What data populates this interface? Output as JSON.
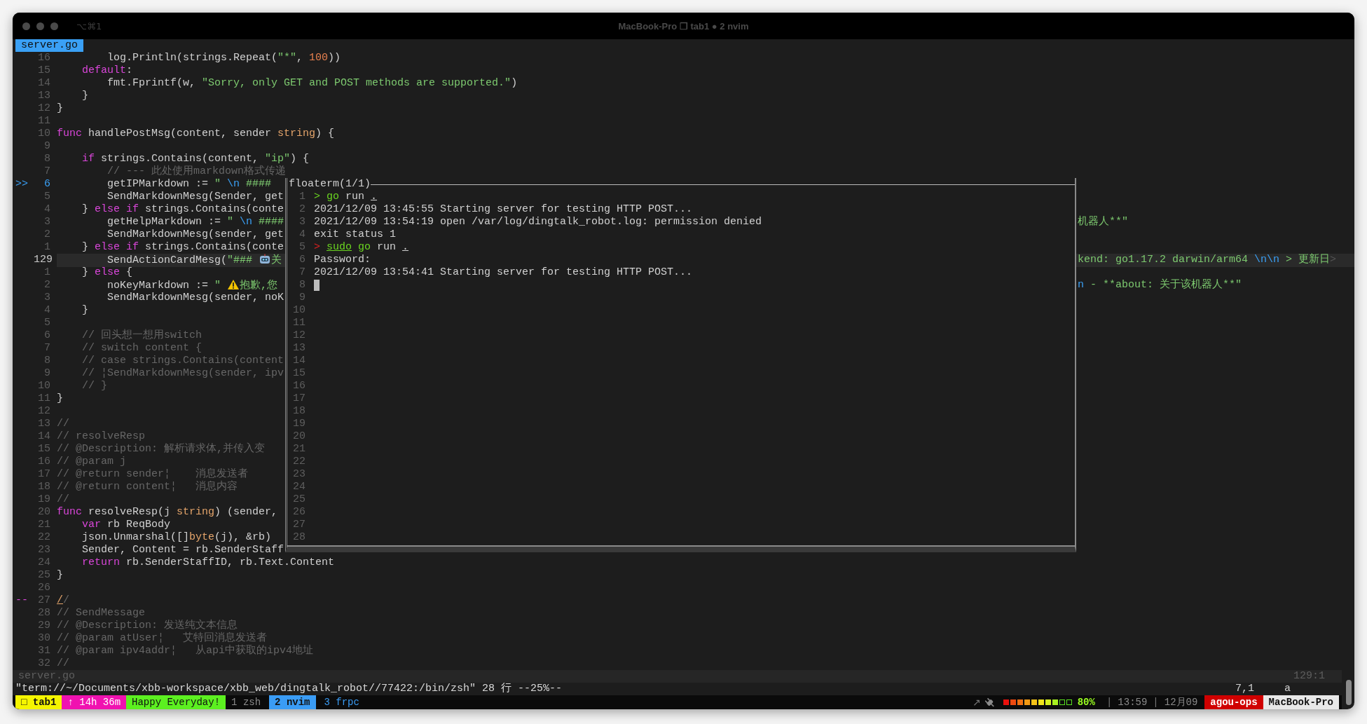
{
  "window": {
    "shortcut": "⌥⌘1",
    "title": "MacBook-Pro ❐ tab1 ● 2 nvim"
  },
  "winbar": {
    "file": "server.go"
  },
  "editor": {
    "lines": [
      {
        "num": "16",
        "current": false,
        "code": [
          "        log.Println(strings.Repeat(",
          {
            "kind": "string",
            "text": "\"*\""
          },
          ", ",
          {
            "kind": "number",
            "text": "100"
          },
          "))"
        ]
      },
      {
        "num": "15",
        "current": false,
        "code": [
          {
            "kind": "keyword",
            "text": "    default"
          },
          ":"
        ]
      },
      {
        "num": "14",
        "current": false,
        "code": [
          "        fmt.Fprintf(w, ",
          {
            "kind": "string",
            "text": "\"Sorry, only GET and POST methods are supported.\""
          },
          ")"
        ]
      },
      {
        "num": "13",
        "current": false,
        "code": [
          "    }"
        ]
      },
      {
        "num": "12",
        "current": false,
        "code": [
          "}"
        ]
      },
      {
        "num": "11",
        "current": false
      },
      {
        "num": "10",
        "current": false,
        "code": [
          {
            "kind": "keyword",
            "text": "func"
          },
          " handlePostMsg(content, sender ",
          {
            "kind": "type",
            "text": "string"
          },
          ") {"
        ]
      },
      {
        "num": "9",
        "current": false
      },
      {
        "num": "8",
        "current": false,
        "code": [
          {
            "kind": "keyword",
            "text": "    if"
          },
          " strings.Contains(content, ",
          {
            "kind": "string",
            "text": "\"ip\""
          },
          ") {"
        ]
      },
      {
        "num": "7",
        "current": false,
        "code": [
          {
            "kind": "comment",
            "text": "        // --- 此处使用markdown格式传递"
          }
        ]
      },
      {
        "num": "6",
        "current": false,
        "sign": {
          "text": ">>",
          "kind": "jump"
        },
        "code": [
          "        getIPMarkdown := ",
          {
            "kind": "string",
            "text": "\" "
          },
          {
            "kind": "escape",
            "text": "\\n"
          },
          {
            "kind": "string",
            "text": " ####"
          }
        ]
      },
      {
        "num": "5",
        "current": false,
        "code": [
          "        SendMarkdownMesg(Sender, get"
        ]
      },
      {
        "num": "4",
        "current": false,
        "code": [
          "    } ",
          {
            "kind": "keyword",
            "text": "else if"
          },
          " strings.Contains(conte"
        ]
      },
      {
        "num": "3",
        "current": false,
        "code": [
          "        getHelpMarkdown := ",
          {
            "kind": "string",
            "text": "\" "
          },
          {
            "kind": "escape",
            "text": "\\n"
          },
          {
            "kind": "string",
            "text": " ####"
          }
        ],
        "right": [
          {
            "kind": "string",
            "text": "机器人**\""
          }
        ]
      },
      {
        "num": "2",
        "current": false,
        "code": [
          "        SendMarkdownMesg(sender, get"
        ]
      },
      {
        "num": "1",
        "current": false,
        "code": [
          "    } ",
          {
            "kind": "keyword",
            "text": "else if"
          },
          " strings.Contains(conte"
        ]
      },
      {
        "num": "129",
        "current": true,
        "code": [
          "        SendActionCardMesg(",
          {
            "kind": "string",
            "text": "\"### "
          },
          {
            "kind": "robot"
          },
          {
            "kind": "string",
            "text": "关"
          }
        ],
        "right": [
          {
            "kind": "string",
            "text": "kend: go1.17.2 darwin/arm64 "
          },
          {
            "kind": "escape",
            "text": "\\n\\n"
          },
          {
            "kind": "string",
            "text": " > 更新日"
          },
          {
            "kind": "more",
            "text": ">"
          }
        ]
      },
      {
        "num": "1",
        "current": false,
        "code": [
          "    } ",
          {
            "kind": "keyword",
            "text": "else"
          },
          " {"
        ]
      },
      {
        "num": "2",
        "current": false,
        "code": [
          "        noKeyMarkdown := ",
          {
            "kind": "string",
            "text": "\" "
          },
          {
            "kind": "warning"
          },
          {
            "kind": "string",
            "text": "抱歉,您"
          }
        ],
        "right": [
          {
            "kind": "escape",
            "text": "n"
          },
          {
            "kind": "string",
            "text": " - **about: 关于该机器人**\""
          }
        ]
      },
      {
        "num": "3",
        "current": false,
        "code": [
          "        SendMarkdownMesg(sender, noK"
        ]
      },
      {
        "num": "4",
        "current": false,
        "code": [
          "    }"
        ]
      },
      {
        "num": "5",
        "current": false
      },
      {
        "num": "6",
        "current": false,
        "code": [
          {
            "kind": "comment",
            "text": "    // 回头想一想用switch"
          }
        ]
      },
      {
        "num": "7",
        "current": false,
        "code": [
          {
            "kind": "comment",
            "text": "    // switch content {"
          }
        ]
      },
      {
        "num": "8",
        "current": false,
        "code": [
          {
            "kind": "comment",
            "text": "    // case strings.Contains(content"
          }
        ]
      },
      {
        "num": "9",
        "current": false,
        "code": [
          {
            "kind": "comment",
            "text": "    // ¦SendMarkdownMesg(sender, ipv"
          }
        ]
      },
      {
        "num": "10",
        "current": false,
        "code": [
          {
            "kind": "comment",
            "text": "    // }"
          }
        ]
      },
      {
        "num": "11",
        "current": false,
        "code": [
          "}"
        ]
      },
      {
        "num": "12",
        "current": false
      },
      {
        "num": "13",
        "current": false,
        "code": [
          {
            "kind": "comment",
            "text": "//"
          }
        ]
      },
      {
        "num": "14",
        "current": false,
        "code": [
          {
            "kind": "comment",
            "text": "// resolveResp"
          }
        ]
      },
      {
        "num": "15",
        "current": false,
        "code": [
          {
            "kind": "comment",
            "text": "// @Description: 解析请求体,并传入变"
          }
        ]
      },
      {
        "num": "16",
        "current": false,
        "code": [
          {
            "kind": "comment",
            "text": "// @param j"
          }
        ]
      },
      {
        "num": "17",
        "current": false,
        "code": [
          {
            "kind": "comment",
            "text": "// @return sender¦    消息发送者"
          }
        ]
      },
      {
        "num": "18",
        "current": false,
        "code": [
          {
            "kind": "comment",
            "text": "// @return content¦   消息内容"
          }
        ]
      },
      {
        "num": "19",
        "current": false,
        "code": [
          {
            "kind": "comment",
            "text": "//"
          }
        ]
      },
      {
        "num": "20",
        "current": false,
        "code": [
          {
            "kind": "keyword",
            "text": "func"
          },
          " resolveResp(j ",
          {
            "kind": "type",
            "text": "string"
          },
          ") (sender,"
        ]
      },
      {
        "num": "21",
        "current": false,
        "code": [
          {
            "kind": "keyword",
            "text": "    var"
          },
          " rb ReqBody"
        ]
      },
      {
        "num": "22",
        "current": false,
        "code": [
          "    json.Unmarshal([]",
          {
            "kind": "type",
            "text": "byte"
          },
          "(j), &rb)"
        ]
      },
      {
        "num": "23",
        "current": false,
        "code": [
          "    Sender, Content = rb.SenderStaff"
        ]
      },
      {
        "num": "24",
        "current": false,
        "code": [
          {
            "kind": "keyword",
            "text": "    return"
          },
          " rb.SenderStaffID, rb.Text.Content"
        ]
      },
      {
        "num": "25",
        "current": false,
        "code": [
          "}"
        ]
      },
      {
        "num": "26",
        "current": false
      },
      {
        "num": "27",
        "current": false,
        "sign": {
          "text": "--",
          "kind": "change"
        },
        "code": [
          {
            "kind": "match",
            "text": "/"
          },
          {
            "kind": "comment",
            "text": "/"
          }
        ]
      },
      {
        "num": "28",
        "current": false,
        "code": [
          {
            "kind": "comment",
            "text": "// SendMessage"
          }
        ]
      },
      {
        "num": "29",
        "current": false,
        "code": [
          {
            "kind": "comment",
            "text": "// @Description: 发送纯文本信息"
          }
        ]
      },
      {
        "num": "30",
        "current": false,
        "code": [
          {
            "kind": "comment",
            "text": "// @param atUser¦   艾特回消息发送者"
          }
        ]
      },
      {
        "num": "31",
        "current": false,
        "code": [
          {
            "kind": "comment",
            "text": "// @param ipv4addr¦   从api中获取的ipv4地址"
          }
        ]
      },
      {
        "num": "32",
        "current": false,
        "code": [
          {
            "kind": "comment",
            "text": "//"
          }
        ]
      }
    ]
  },
  "floaterm": {
    "title": "floaterm(1/1)",
    "lines": [
      {
        "num": "1",
        "cursor": false,
        "segments": [
          {
            "kind": "prompt_ok",
            "text": "> go"
          },
          " run ",
          {
            "kind": "path",
            "text": "."
          }
        ]
      },
      {
        "num": "2",
        "cursor": false,
        "segments": [
          "2021/12/09 13:45:55 Starting server for testing HTTP POST..."
        ]
      },
      {
        "num": "3",
        "cursor": false,
        "segments": [
          "2021/12/09 13:54:19 open /var/log/dingtalk_robot.log: permission denied"
        ]
      },
      {
        "num": "4",
        "cursor": false,
        "segments": [
          "exit status 1"
        ]
      },
      {
        "num": "5",
        "cursor": false,
        "segments": [
          {
            "kind": "prompt_error",
            "text": "> "
          },
          {
            "kind": "command_valid",
            "text": "sudo"
          },
          {
            "kind": "command",
            "text": " go"
          },
          " run ",
          {
            "kind": "path",
            "text": "."
          }
        ]
      },
      {
        "num": "6",
        "cursor": false,
        "segments": [
          "Password:"
        ]
      },
      {
        "num": "7",
        "cursor": false,
        "segments": [
          "2021/12/09 13:54:41 Starting server for testing HTTP POST..."
        ]
      },
      {
        "num": "8",
        "cursor": true
      },
      {
        "num": "9",
        "cursor": false
      },
      {
        "num": "10",
        "cursor": false
      },
      {
        "num": "11",
        "cursor": false
      },
      {
        "num": "12",
        "cursor": false
      },
      {
        "num": "13",
        "cursor": false
      },
      {
        "num": "14",
        "cursor": false
      },
      {
        "num": "15",
        "cursor": false
      },
      {
        "num": "16",
        "cursor": false
      },
      {
        "num": "17",
        "cursor": false
      },
      {
        "num": "18",
        "cursor": false
      },
      {
        "num": "19",
        "cursor": false
      },
      {
        "num": "20",
        "cursor": false
      },
      {
        "num": "21",
        "cursor": false
      },
      {
        "num": "22",
        "cursor": false
      },
      {
        "num": "23",
        "cursor": false
      },
      {
        "num": "24",
        "cursor": false
      },
      {
        "num": "25",
        "cursor": false
      },
      {
        "num": "26",
        "cursor": false
      },
      {
        "num": "27",
        "cursor": false
      },
      {
        "num": "28",
        "cursor": false
      }
    ]
  },
  "status_line": {
    "file": "server.go",
    "position": "129:1"
  },
  "command_line": {
    "text": "\"term://~/Documents/xbb-workspace/xbb_web/dingtalk_robot//77422:/bin/zsh\" 28 行 --25%--",
    "ruler": "7,1",
    "showcmd": "a"
  },
  "tmux": {
    "segments": [
      {
        "kind": "session",
        "text": "□ tab1"
      },
      {
        "kind": "uptime",
        "text": "↑ 14h 36m"
      },
      {
        "kind": "motto",
        "text": "Happy Everyday!"
      }
    ],
    "windows": [
      {
        "label": "1 zsh",
        "selected": false,
        "activity": false
      },
      {
        "label": "2 nvim",
        "selected": true,
        "activity": false
      },
      {
        "label": "3 frpc",
        "selected": false,
        "activity": true
      }
    ],
    "arrow": "↗",
    "charging": true,
    "battery": {
      "level": 0.8,
      "reading": "80%"
    },
    "separators": [
      "|",
      "|"
    ],
    "time": "13:59",
    "date": "12月09",
    "user": "agou-ops",
    "host": "MacBook-Pro"
  }
}
